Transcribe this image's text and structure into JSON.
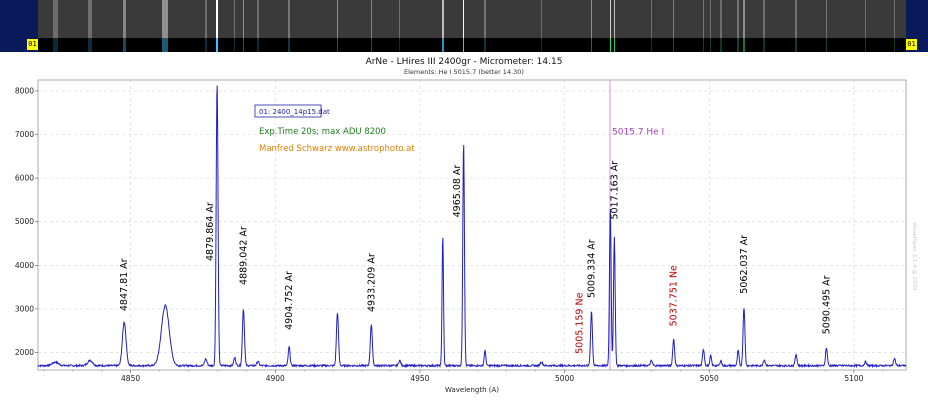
{
  "colors": {
    "frame": "#0a1a5a",
    "spectrum": "#2020c0",
    "marker_line": "#c080e0",
    "ar_label": "#000000",
    "ne_label": "#c00000",
    "exposure_text": "#208020",
    "author_text": "#e08000",
    "marker_text": "#a040c0",
    "badge": "#ffff00"
  },
  "header": {
    "left_marker": "01",
    "right_marker": "01"
  },
  "chart_data": {
    "type": "line",
    "title": "ArNe - LHires III 2400gr - Micrometer: 14.15",
    "subtitle": "Elements: He I 5015.7 (better 14.30)",
    "xlabel": "Wavelength (A)",
    "ylabel": "",
    "xlim": [
      4818,
      5118
    ],
    "ylim": [
      1600,
      8250
    ],
    "xticks": [
      4850,
      4900,
      4950,
      5000,
      5050,
      5100
    ],
    "yticks": [
      2000,
      3000,
      4000,
      5000,
      6000,
      7000,
      8000
    ],
    "grid": true,
    "legend_box": "01: 2400_14p15.dat",
    "annotations": {
      "exposure": "Exp.Time 20s; max ADU 8200",
      "author": "Manfred Schwarz www.astrophoto.at",
      "watermark": "VisualSpec 3.1.4 @ 2009"
    },
    "marker": {
      "x": 5015.7,
      "label": "5015.7 He I"
    },
    "baseline": 1700,
    "series": [
      {
        "peaks": [
          {
            "x": 4824,
            "y": 1780,
            "w": 1.5
          },
          {
            "x": 4836,
            "y": 1820,
            "w": 1.2
          },
          {
            "x": 4847.8,
            "y": 2700,
            "w": 0.9
          },
          {
            "x": 4862,
            "y": 3080,
            "w": 1.9
          },
          {
            "x": 4876,
            "y": 1850,
            "w": 0.6
          },
          {
            "x": 4879.9,
            "y": 8200,
            "w": 0.45
          },
          {
            "x": 4886,
            "y": 1880,
            "w": 0.5
          },
          {
            "x": 4889.0,
            "y": 3000,
            "w": 0.5
          },
          {
            "x": 4894,
            "y": 1800,
            "w": 0.5
          },
          {
            "x": 4904.8,
            "y": 2130,
            "w": 0.45
          },
          {
            "x": 4921.5,
            "y": 2920,
            "w": 0.5
          },
          {
            "x": 4933.2,
            "y": 2640,
            "w": 0.5
          },
          {
            "x": 4943,
            "y": 1820,
            "w": 0.5
          },
          {
            "x": 4957.9,
            "y": 4700,
            "w": 0.35
          },
          {
            "x": 4965.1,
            "y": 6850,
            "w": 0.4
          },
          {
            "x": 4972.5,
            "y": 2050,
            "w": 0.4
          },
          {
            "x": 4992,
            "y": 1780,
            "w": 0.6
          },
          {
            "x": 5009.3,
            "y": 2950,
            "w": 0.45
          },
          {
            "x": 5015.8,
            "y": 5350,
            "w": 0.4
          },
          {
            "x": 5017.2,
            "y": 4650,
            "w": 0.4
          },
          {
            "x": 5030,
            "y": 1810,
            "w": 0.5
          },
          {
            "x": 5037.7,
            "y": 2310,
            "w": 0.45
          },
          {
            "x": 5048,
            "y": 2080,
            "w": 0.45
          },
          {
            "x": 5050.5,
            "y": 1930,
            "w": 0.4
          },
          {
            "x": 5054,
            "y": 1820,
            "w": 0.4
          },
          {
            "x": 5060,
            "y": 2050,
            "w": 0.4
          },
          {
            "x": 5062.0,
            "y": 3050,
            "w": 0.45
          },
          {
            "x": 5069,
            "y": 1830,
            "w": 0.5
          },
          {
            "x": 5080,
            "y": 1960,
            "w": 0.45
          },
          {
            "x": 5090.5,
            "y": 2110,
            "w": 0.45
          },
          {
            "x": 5104,
            "y": 1790,
            "w": 0.5
          },
          {
            "x": 5114,
            "y": 1860,
            "w": 0.5
          }
        ]
      }
    ],
    "labels": [
      {
        "text": "4847.81 Ar",
        "x": 4847.8,
        "y": 2950,
        "element": "Ar"
      },
      {
        "text": "4879.864 Ar",
        "x": 4877.5,
        "y": 4100,
        "element": "Ar"
      },
      {
        "text": "4889.042 Ar",
        "x": 4889.0,
        "y": 3550,
        "element": "Ar"
      },
      {
        "text": "4904.752 Ar",
        "x": 4904.8,
        "y": 2520,
        "element": "Ar"
      },
      {
        "text": "4933.209 Ar",
        "x": 4933.2,
        "y": 2930,
        "element": "Ar"
      },
      {
        "text": "4965.08 Ar",
        "x": 4962.8,
        "y": 5100,
        "element": "Ar"
      },
      {
        "text": "5005.159 Ne",
        "x": 5005.2,
        "y": 1970,
        "element": "Ne"
      },
      {
        "text": "5009.334 Ar",
        "x": 5009.3,
        "y": 3250,
        "element": "Ar"
      },
      {
        "text": "5017.163 Ar",
        "x": 5017.2,
        "y": 5050,
        "element": "Ar"
      },
      {
        "text": "5037.751 Ne",
        "x": 5037.7,
        "y": 2600,
        "element": "Ne"
      },
      {
        "text": "5062.037 Ar",
        "x": 5062.0,
        "y": 3350,
        "element": "Ar"
      },
      {
        "text": "5090.495 Ar",
        "x": 5090.5,
        "y": 2420,
        "element": "Ar"
      }
    ]
  }
}
